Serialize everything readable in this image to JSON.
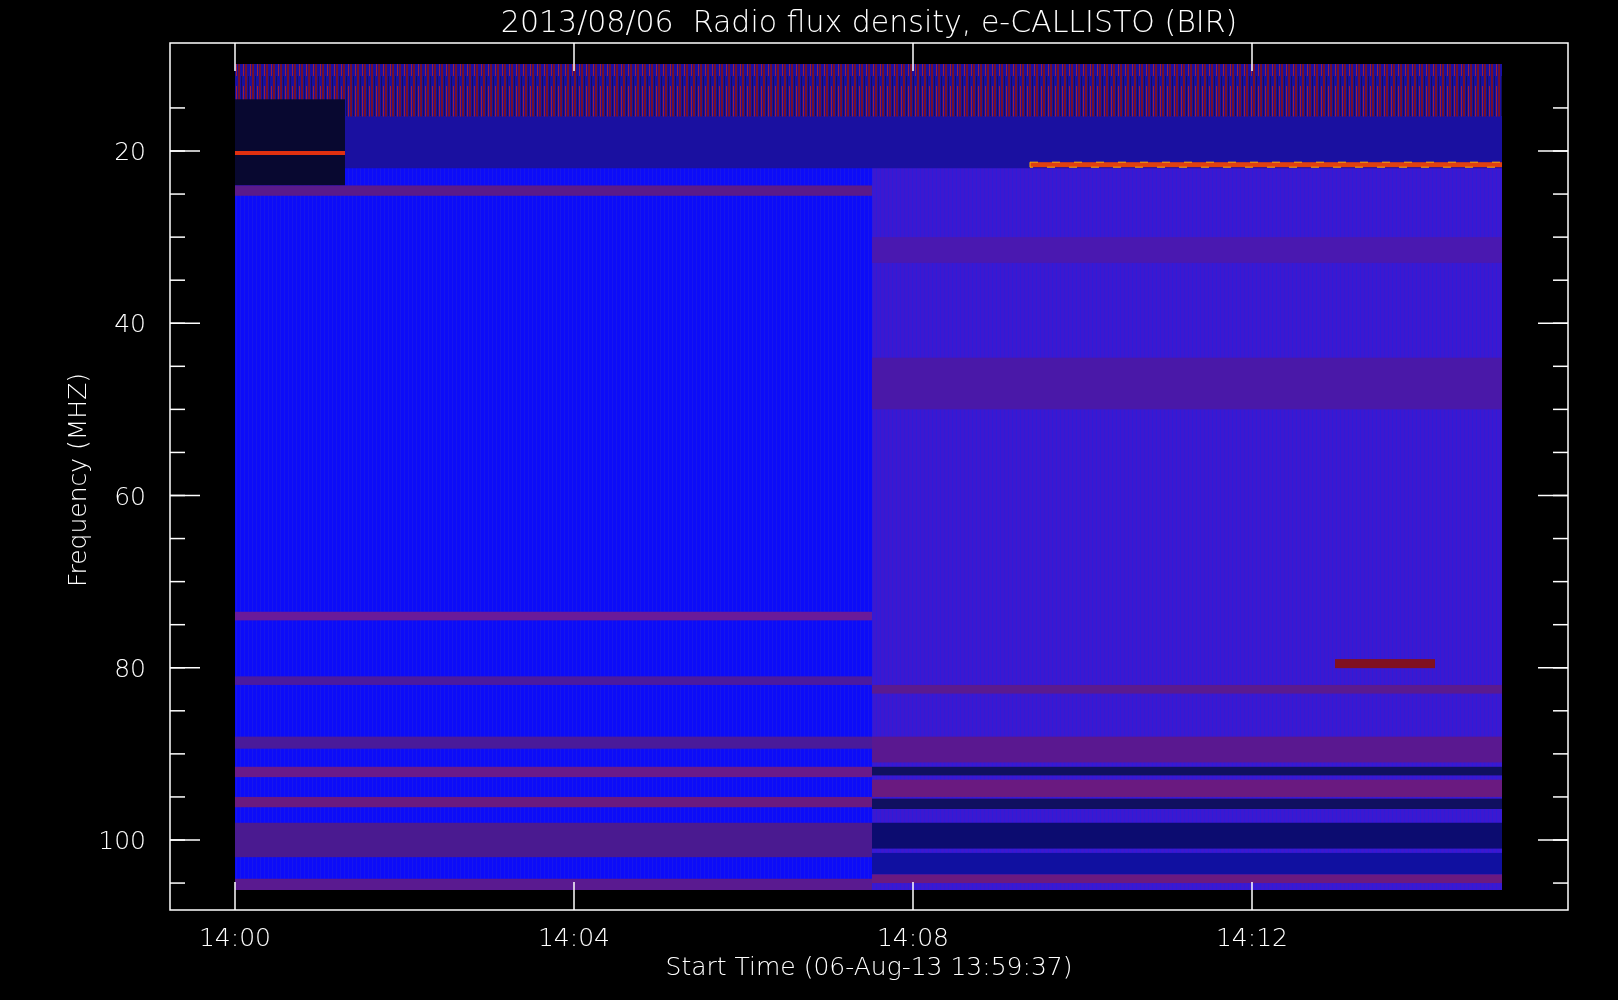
{
  "title": "2013/08/06  Radio flux density, e-CALLISTO (BIR)",
  "plot": {
    "y_axis": {
      "label": "Frequency (MHZ)",
      "ticks": [
        "20",
        "40",
        "60",
        "80",
        "100"
      ]
    },
    "x_axis": {
      "label": "Start Time (06-Aug-13 13:59:37)",
      "ticks": [
        "14:00",
        "14:04",
        "14:08",
        "14:12"
      ]
    }
  }
}
